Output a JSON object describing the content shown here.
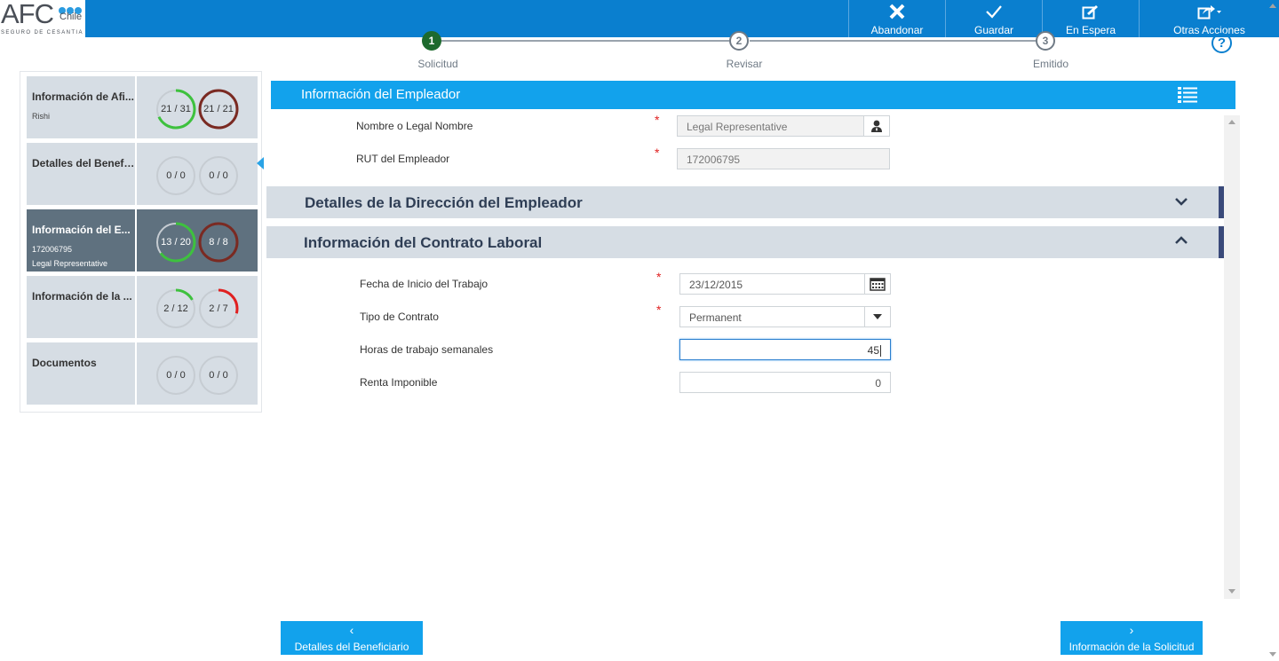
{
  "logo": {
    "brand": "AFC",
    "country": "Chile",
    "tagline": "SEGURO DE CESANTIA"
  },
  "toolbar": {
    "abandon_label": "Abandonar",
    "save_label": "Guardar",
    "hold_label": "En Espera",
    "more_label": "Otras Acciones"
  },
  "stepper": {
    "steps": [
      {
        "number": "1",
        "label": "Solicitud",
        "state": "active"
      },
      {
        "number": "2",
        "label": "Revisar",
        "state": "pending"
      },
      {
        "number": "3",
        "label": "Emitido",
        "state": "pending"
      }
    ],
    "help": "?"
  },
  "sidebar": {
    "items": [
      {
        "title": "Información de Afi...",
        "sub1": "Rishi",
        "sub2": "",
        "ring1": "21 / 31",
        "ring1_fraction": 0.68,
        "ring1_color": "#3ec13e",
        "ring2": "21 / 21",
        "ring2_fraction": 1.0,
        "ring2_color": "#7a2a22"
      },
      {
        "title": "Detalles del Benefi...",
        "sub1": "",
        "sub2": "",
        "ring1": "0 / 0",
        "ring1_fraction": 0,
        "ring1_color": "#3ec13e",
        "ring2": "0 / 0",
        "ring2_fraction": 0,
        "ring2_color": "#7a2a22"
      },
      {
        "title": "Información del E...",
        "sub1": "172006795",
        "sub2": "Legal Representative",
        "ring1": "13 / 20",
        "ring1_fraction": 0.65,
        "ring1_color": "#3ec13e",
        "ring2": "8 / 8",
        "ring2_fraction": 1.0,
        "ring2_color": "#7a2a22"
      },
      {
        "title": "Información de la ...",
        "sub1": "",
        "sub2": "",
        "ring1": "2 / 12",
        "ring1_fraction": 0.17,
        "ring1_color": "#3ec13e",
        "ring2": "2 / 7",
        "ring2_fraction": 0.29,
        "ring2_color": "#e02020"
      },
      {
        "title": "Documentos",
        "sub1": "",
        "sub2": "",
        "ring1": "0 / 0",
        "ring1_fraction": 0,
        "ring1_color": "#3ec13e",
        "ring2": "0 / 0",
        "ring2_fraction": 0,
        "ring2_color": "#7a2a22"
      }
    ]
  },
  "employer": {
    "section_title": "Información del Empleador",
    "name_label": "Nombre o Legal Nombre",
    "name_value": "Legal Representative",
    "rut_label": "RUT del Empleador",
    "rut_value": "172006795",
    "required_mark": "*"
  },
  "address": {
    "title": "Detalles de la Dirección del Empleador"
  },
  "contract": {
    "title": "Información del Contrato Laboral",
    "start_label": "Fecha de Inicio del Trabajo",
    "start_value": "23/12/2015",
    "type_label": "Tipo de Contrato",
    "type_value": "Permanent",
    "hours_label": "Horas de trabajo semanales",
    "hours_value": "45",
    "income_label": "Renta Imponible",
    "income_value": "0"
  },
  "footer": {
    "prev_label": "Detalles del Beneficiario",
    "next_label": "Información de la Solicitud"
  },
  "colors": {
    "topbar": "#0a7fcf",
    "accent": "#12a2ec",
    "active_step": "#1e6a2e",
    "active_card": "#5f717f"
  }
}
